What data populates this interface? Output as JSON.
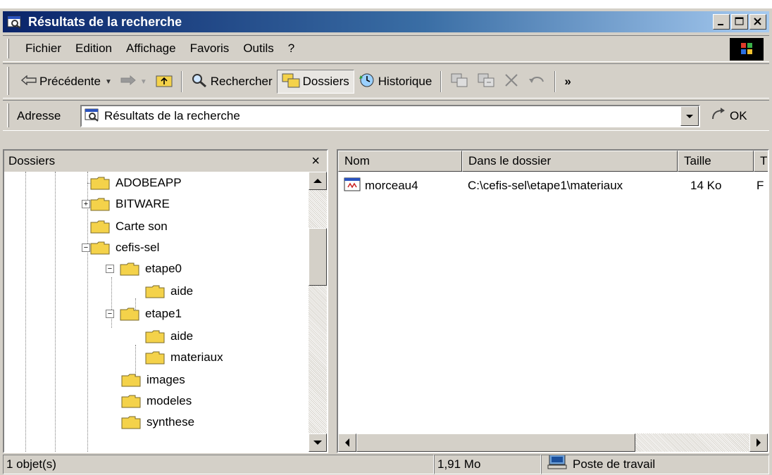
{
  "window": {
    "title": "Résultats de la recherche"
  },
  "menu": [
    "Fichier",
    "Edition",
    "Affichage",
    "Favoris",
    "Outils",
    "?"
  ],
  "toolbar": {
    "back_label": "Précédente",
    "search_label": "Rechercher",
    "folders_label": "Dossiers",
    "history_label": "Historique",
    "more_label": "»"
  },
  "address": {
    "label": "Adresse",
    "value": "Résultats de la recherche",
    "go_label": "OK"
  },
  "folders_pane": {
    "title": "Dossiers",
    "close_label": "×",
    "items": [
      {
        "label": "ADOBEAPP"
      },
      {
        "label": "BITWARE"
      },
      {
        "label": "Carte son"
      },
      {
        "label": "cefis-sel"
      },
      {
        "label": "etape0"
      },
      {
        "label": "aide"
      },
      {
        "label": "etape1"
      },
      {
        "label": "aide"
      },
      {
        "label": "materiaux"
      },
      {
        "label": "images"
      },
      {
        "label": "modeles"
      },
      {
        "label": "synthese"
      }
    ]
  },
  "results": {
    "columns": [
      "Nom",
      "Dans le dossier",
      "Taille",
      "T"
    ],
    "rows": [
      {
        "name": "morceau4",
        "folder": "C:\\cefis-sel\\etape1\\materiaux",
        "size": "14 Ko",
        "type": "F"
      }
    ]
  },
  "status": {
    "count": "1 objet(s)",
    "size": "1,91 Mo",
    "location": "Poste de travail"
  },
  "colors": {
    "title_start": "#0a246a",
    "title_end": "#a6caf0",
    "chrome": "#d4d0c8",
    "folder": "#f4d24a"
  }
}
